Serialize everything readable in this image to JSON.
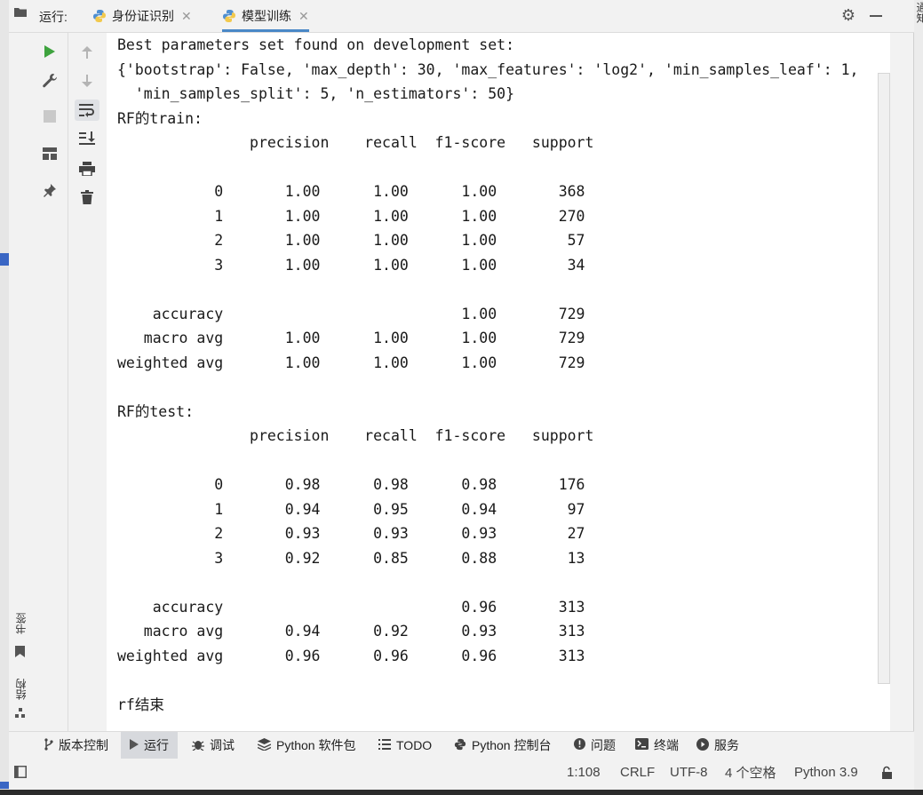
{
  "tabs": {
    "run_label": "运行:",
    "items": [
      {
        "label": "身份证识别",
        "active": false
      },
      {
        "label": "模型训练",
        "active": true
      }
    ]
  },
  "console": {
    "lines": [
      "Best parameters set found on development set:",
      "{'bootstrap': False, 'max_depth': 30, 'max_features': 'log2', 'min_samples_leaf': 1,",
      "  'min_samples_split': 5, 'n_estimators': 50}",
      "RF的train:",
      "               precision    recall  f1-score   support",
      "",
      "           0       1.00      1.00      1.00       368",
      "           1       1.00      1.00      1.00       270",
      "           2       1.00      1.00      1.00        57",
      "           3       1.00      1.00      1.00        34",
      "",
      "    accuracy                           1.00       729",
      "   macro avg       1.00      1.00      1.00       729",
      "weighted avg       1.00      1.00      1.00       729",
      "",
      "RF的test:",
      "               precision    recall  f1-score   support",
      "",
      "           0       0.98      0.98      0.98       176",
      "           1       0.94      0.95      0.94        97",
      "           2       0.93      0.93      0.93        27",
      "           3       0.92      0.85      0.88        13",
      "",
      "    accuracy                           0.96       313",
      "   macro avg       0.94      0.92      0.93       313",
      "weighted avg       0.96      0.96      0.96       313",
      "",
      "rf结束"
    ]
  },
  "left_tools": {
    "bookmarks": "书签",
    "structure": "结构"
  },
  "right_strip": {
    "label": "通知"
  },
  "tool_windows": [
    {
      "label": "版本控制",
      "icon": "branch-icon",
      "active": false
    },
    {
      "label": "运行",
      "icon": "run-icon",
      "active": true
    },
    {
      "label": "调试",
      "icon": "bug-icon",
      "active": false
    },
    {
      "label": "Python 软件包",
      "icon": "layers-icon",
      "active": false
    },
    {
      "label": "TODO",
      "icon": "list-icon",
      "active": false
    },
    {
      "label": "Python 控制台",
      "icon": "python-icon",
      "active": false
    },
    {
      "label": "问题",
      "icon": "warning-icon",
      "active": false
    },
    {
      "label": "终端",
      "icon": "terminal-icon",
      "active": false
    },
    {
      "label": "服务",
      "icon": "services-icon",
      "active": false
    }
  ],
  "status": {
    "position": "1:108",
    "line_sep": "CRLF",
    "encoding": "UTF-8",
    "indent": "4 个空格",
    "interpreter": "Python 3.9"
  },
  "colors": {
    "accent": "#4a88c7",
    "run_green": "#3ea33e",
    "console_bg": "#ffffff"
  }
}
